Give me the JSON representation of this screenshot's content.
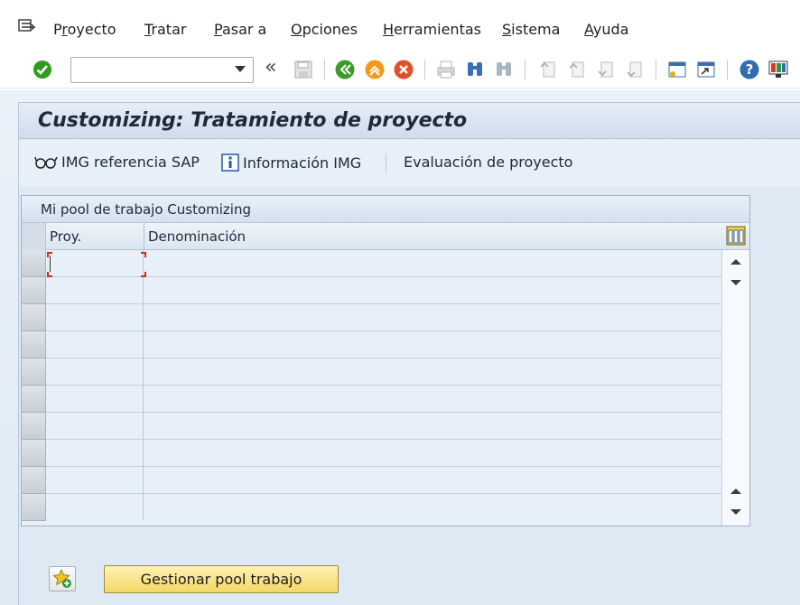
{
  "menu": {
    "items": [
      {
        "label": "Proyecto",
        "key": "r"
      },
      {
        "label": "Tratar",
        "key": "T"
      },
      {
        "label": "Pasar a",
        "key": "P"
      },
      {
        "label": "Opciones",
        "key": "O"
      },
      {
        "label": "Herramientas",
        "key": "H"
      },
      {
        "label": "Sistema",
        "key": "S"
      },
      {
        "label": "Ayuda",
        "key": "A"
      }
    ]
  },
  "toolbar": {
    "command_field": {
      "value": "",
      "placeholder": ""
    },
    "double_arrow": "«"
  },
  "screen": {
    "title": "Customizing: Tratamiento de proyecto"
  },
  "app_toolbar": {
    "img_reference": "IMG referencia SAP",
    "img_info": "Información IMG",
    "project_eval": "Evaluación de proyecto"
  },
  "table": {
    "title": "Mi pool de trabajo Customizing",
    "columns": [
      "Proy.",
      "Denominación"
    ],
    "rows": [
      [
        "",
        ""
      ],
      [
        "",
        ""
      ],
      [
        "",
        ""
      ],
      [
        "",
        ""
      ],
      [
        "",
        ""
      ],
      [
        "",
        ""
      ],
      [
        "",
        ""
      ],
      [
        "",
        ""
      ],
      [
        "",
        ""
      ],
      [
        "",
        ""
      ]
    ]
  },
  "footer": {
    "manage_button": "Gestionar pool trabajo"
  },
  "colors": {
    "accent_yellow": "#f3d767",
    "panel_bg": "#dfe9f4",
    "ok_green": "#2e9b1f",
    "exit_orange": "#f29a1c",
    "cancel_red": "#e0502a"
  },
  "icons": [
    "menu-icon",
    "ok-icon",
    "dropdown-icon",
    "save-icon",
    "back-icon",
    "exit-icon",
    "cancel-icon",
    "print-icon",
    "find-icon",
    "find-next-icon",
    "first-page-icon",
    "prev-page-icon",
    "next-page-icon",
    "last-page-icon",
    "new-session-icon",
    "shortcut-icon",
    "help-icon",
    "layout-icon",
    "glasses-icon",
    "info-icon",
    "column-settings-icon",
    "star-add-icon"
  ]
}
